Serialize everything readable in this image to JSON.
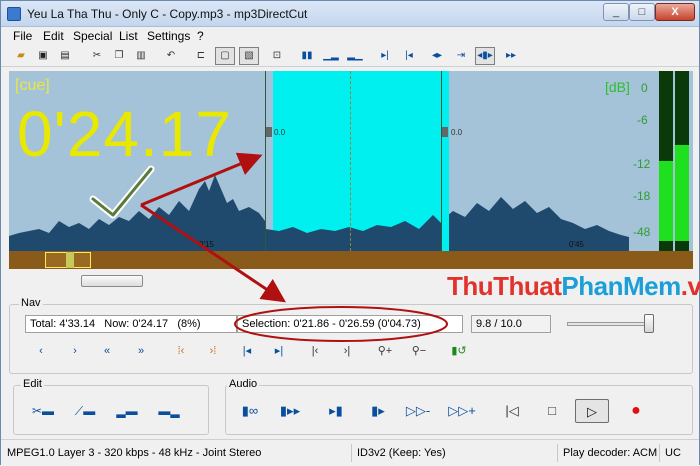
{
  "window": {
    "title": "Yeu La Tha Thu - Only C - Copy.mp3 - mp3DirectCut",
    "min": "_",
    "max": "□",
    "close": "X"
  },
  "menu": [
    "File",
    "Edit",
    "Special",
    "List",
    "Settings",
    "?"
  ],
  "waveform": {
    "cue_label": "[cue]",
    "time_display": "0'24.17",
    "db_title": "[dB]",
    "db_scale": [
      "0",
      "-6",
      "-12",
      "-18",
      "-48"
    ],
    "marker_values": [
      "0.0",
      "0.0"
    ],
    "colors": {
      "wave": "#a4c2d8",
      "selection": "#00f0f0",
      "time": "#e8e800",
      "meter": "#1fe01f"
    }
  },
  "nav": {
    "label": "Nav",
    "total": "Total: 4'33.14",
    "now": "Now: 0'24.17",
    "percent": "(8%)",
    "selection": "Selection: 0'21.86 - 0'26.59 (0'04.73)",
    "volume": "9.8 / 10.0",
    "slider_level": 0.95
  },
  "edit": {
    "label": "Edit"
  },
  "audio": {
    "label": "Audio"
  },
  "watermark": {
    "part1": "ThuThuat",
    "part2": "PhanMem",
    "part3": ".vn"
  },
  "status": {
    "format": "MPEG1.0 Layer 3 - 320 kbps - 48 kHz - Joint Stereo",
    "id3": "ID3v2 (Keep: Yes)",
    "decoder": "Play decoder: ACM",
    "uc": "UC"
  },
  "icons": {
    "toolbar": [
      "open-file-icon",
      "save-icon",
      "save-as-icon",
      "cut-icon",
      "copy-icon",
      "paste-icon",
      "undo-icon",
      "cue-mode-icon",
      "zoom-mode-icon",
      "zoom-mode-2-icon",
      "set-cue-icon",
      "normalize-icon",
      "fade-icon",
      "volume-icon",
      "mark-in-icon",
      "mark-out-icon",
      "select-all-icon",
      "split-icon",
      "trim-icon",
      "crop-icon"
    ],
    "nav": [
      "step-back-icon",
      "step-forward-icon",
      "skip-back-icon",
      "skip-forward-icon",
      "go-start-selection-icon",
      "go-end-selection-icon",
      "mark-start-icon",
      "mark-end-icon",
      "prev-cue-icon",
      "next-cue-icon",
      "zoom-in-icon",
      "zoom-out-icon",
      "loop-icon"
    ],
    "edit": [
      "cut-marker-icon",
      "fade-marker-icon",
      "normalize-marker-icon",
      "trim-marker-icon"
    ],
    "audio": [
      "play-to-cue-icon",
      "play-selection-icon",
      "play-from-cue-icon",
      "play-cue-icon",
      "play-range-icon",
      "fast-forward-icon",
      "stop-start-icon",
      "stop-icon",
      "play-icon",
      "record-icon"
    ]
  }
}
